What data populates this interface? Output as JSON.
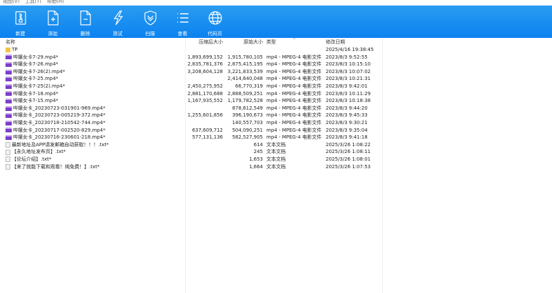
{
  "menu": [
    "视图(V)",
    "工具(T)",
    "帮助(H)"
  ],
  "toolbar": [
    {
      "label": "新建",
      "icon": "archive-icon"
    },
    {
      "label": "添加",
      "icon": "file-add-icon"
    },
    {
      "label": "删除",
      "icon": "file-remove-icon"
    },
    {
      "label": "测试",
      "icon": "lightning-icon"
    },
    {
      "label": "扫描",
      "icon": "shield-icon"
    },
    {
      "label": "查看",
      "icon": "list-icon"
    },
    {
      "label": "代码页",
      "icon": "globe-icon"
    }
  ],
  "columns": {
    "name": "名称",
    "compressed": "压缩后大小",
    "original": "原始大小",
    "type": "类型",
    "date": "修改日期"
  },
  "files": [
    {
      "name": "TP",
      "icon": "folder",
      "compressed": "",
      "original": "",
      "type": "",
      "date": "2025/4/16 19:38:45"
    },
    {
      "name": "哔嬢女卡7-29.mp4*",
      "icon": "video",
      "compressed": "1,893,699,152",
      "original": "1,915,780,105",
      "type": "mp4 - MPEG-4 电影文件",
      "date": "2023/8/3 9:52:55"
    },
    {
      "name": "哔嬢女卡7-26.mp4*",
      "icon": "video",
      "compressed": "2,835,781,376",
      "original": "2,875,415,195",
      "type": "mp4 - MPEG-4 电影文件",
      "date": "2023/8/3 10:15:10"
    },
    {
      "name": "哔嬢女卡7-26(2).mp4*",
      "icon": "video",
      "compressed": "3,208,604,128",
      "original": "3,221,833,539",
      "type": "mp4 - MPEG-4 电影文件",
      "date": "2023/8/3 10:07:02"
    },
    {
      "name": "哔嬢女卡7-25.mp4*",
      "icon": "video",
      "compressed": "",
      "original": "2,414,640,048",
      "type": "mp4 - MPEG-4 电影文件",
      "date": "2023/8/3 10:21:31"
    },
    {
      "name": "哔嬢女卡7-25(2).mp4*",
      "icon": "video",
      "compressed": "2,450,275,952",
      "original": "66,770,319",
      "type": "mp4 - MPEG-4 电影文件",
      "date": "2023/8/3 9:42:01"
    },
    {
      "name": "哔嬢女卡7-18.mp4*",
      "icon": "video",
      "compressed": "2,881,170,688",
      "original": "2,888,509,251",
      "type": "mp4 - MPEG-4 电影文件",
      "date": "2023/8/3 10:11:29"
    },
    {
      "name": "哔嬢女卡7-15.mp4*",
      "icon": "video",
      "compressed": "1,167,935,552",
      "original": "1,179,782,528",
      "type": "mp4 - MPEG-4 电影文件",
      "date": "2023/8/3 10:18:38"
    },
    {
      "name": "哔嬢女卡_20230723-031901-969.mp4*",
      "icon": "video",
      "compressed": "",
      "original": "878,612,549",
      "type": "mp4 - MPEG-4 电影文件",
      "date": "2023/8/3 9:44:20"
    },
    {
      "name": "哔嬢女卡_20230723-005219-372.mp4*",
      "icon": "video",
      "compressed": "1,255,601,856",
      "original": "396,190,673",
      "type": "mp4 - MPEG-4 电影文件",
      "date": "2023/8/3 9:45:33"
    },
    {
      "name": "哔嬢女卡_20230718-210542-744.mp4*",
      "icon": "video",
      "compressed": "",
      "original": "140,557,703",
      "type": "mp4 - MPEG-4 电影文件",
      "date": "2023/8/3 9:30:21"
    },
    {
      "name": "哔嬢女卡_20230717-002520-829.mp4*",
      "icon": "video",
      "compressed": "637,609,712",
      "original": "504,090,251",
      "type": "mp4 - MPEG-4 电影文件",
      "date": "2023/8/3 9:35:04"
    },
    {
      "name": "哔嬢女卡_20230716-230601-218.mp4*",
      "icon": "video",
      "compressed": "577,131,136",
      "original": "582,527,905",
      "type": "mp4 - MPEG-4 电影文件",
      "date": "2023/8/3 9:41:18"
    },
    {
      "name": "最新地址及APP请发邮箱自动获取！！！.txt*",
      "icon": "txt",
      "compressed": "",
      "original": "614",
      "type": "文本文档",
      "date": "2025/3/26 1:08:22"
    },
    {
      "name": "【永久地址发布页】.txt*",
      "icon": "txt",
      "compressed": "",
      "original": "245",
      "type": "文本文档",
      "date": "2025/3/26 1:08:11"
    },
    {
      "name": "【论坛介绍】.txt*",
      "icon": "txt",
      "compressed": "",
      "original": "1,653",
      "type": "文本文档",
      "date": "2025/3/26 1:08:01"
    },
    {
      "name": "【来了就能下载和观看！纯免费！】.txt*",
      "icon": "txt",
      "compressed": "",
      "original": "1,664",
      "type": "文本文档",
      "date": "2025/3/26 1:07:53"
    }
  ]
}
